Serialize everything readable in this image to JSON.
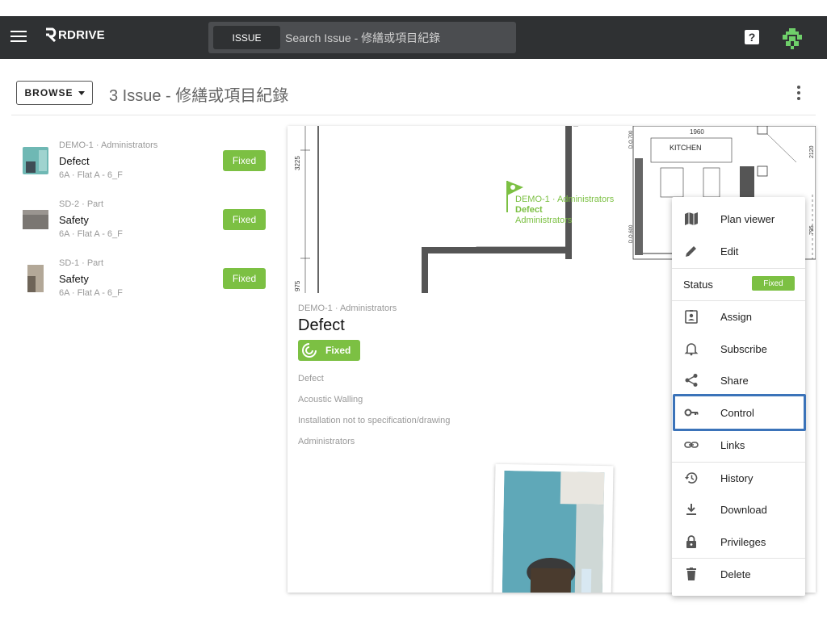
{
  "app": {
    "logo_text": "RDRIVE"
  },
  "search": {
    "tab_label": "ISSUE",
    "placeholder": "Search Issue - 修繕或項目紀錄"
  },
  "header": {
    "browse_label": "BROWSE",
    "title": "3 Issue - 修繕或項目紀錄"
  },
  "issues": [
    {
      "meta": "DEMO-1 · Administrators",
      "title": "Defect",
      "sub": "6A · Flat A - 6_F",
      "status": "Fixed"
    },
    {
      "meta": "SD-2 · Part",
      "title": "Safety",
      "sub": "6A · Flat A - 6_F",
      "status": "Fixed"
    },
    {
      "meta": "SD-1 · Part",
      "title": "Safety",
      "sub": "6A · Flat A - 6_F",
      "status": "Fixed"
    }
  ],
  "plan": {
    "dim_3225": "3225",
    "dim_975": "975",
    "dim_1960": "1960",
    "dim_2120": "2120",
    "dim_795": "795",
    "do_700": "D.O.700",
    "do_600": "D.O.600",
    "kitchen": "KITCHEN",
    "marker_meta": "DEMO-1 · Administrators",
    "marker_title": "Defect",
    "marker_sub": "Administrators"
  },
  "detail": {
    "meta": "DEMO-1 · Administrators",
    "title": "Defect",
    "status": "Fixed",
    "category": "Defect",
    "type": "Acoustic Walling",
    "description": "Installation not to specification/drawing",
    "assignee": "Administrators"
  },
  "menu": {
    "plan_viewer": "Plan viewer",
    "edit": "Edit",
    "status_label": "Status",
    "status_value": "Fixed",
    "assign": "Assign",
    "subscribe": "Subscribe",
    "share": "Share",
    "control": "Control",
    "links": "Links",
    "history": "History",
    "download": "Download",
    "privileges": "Privileges",
    "delete": "Delete"
  },
  "colors": {
    "appbar": "#2f3133",
    "accent_green": "#7cc043",
    "highlight_blue": "#3b73b9"
  }
}
